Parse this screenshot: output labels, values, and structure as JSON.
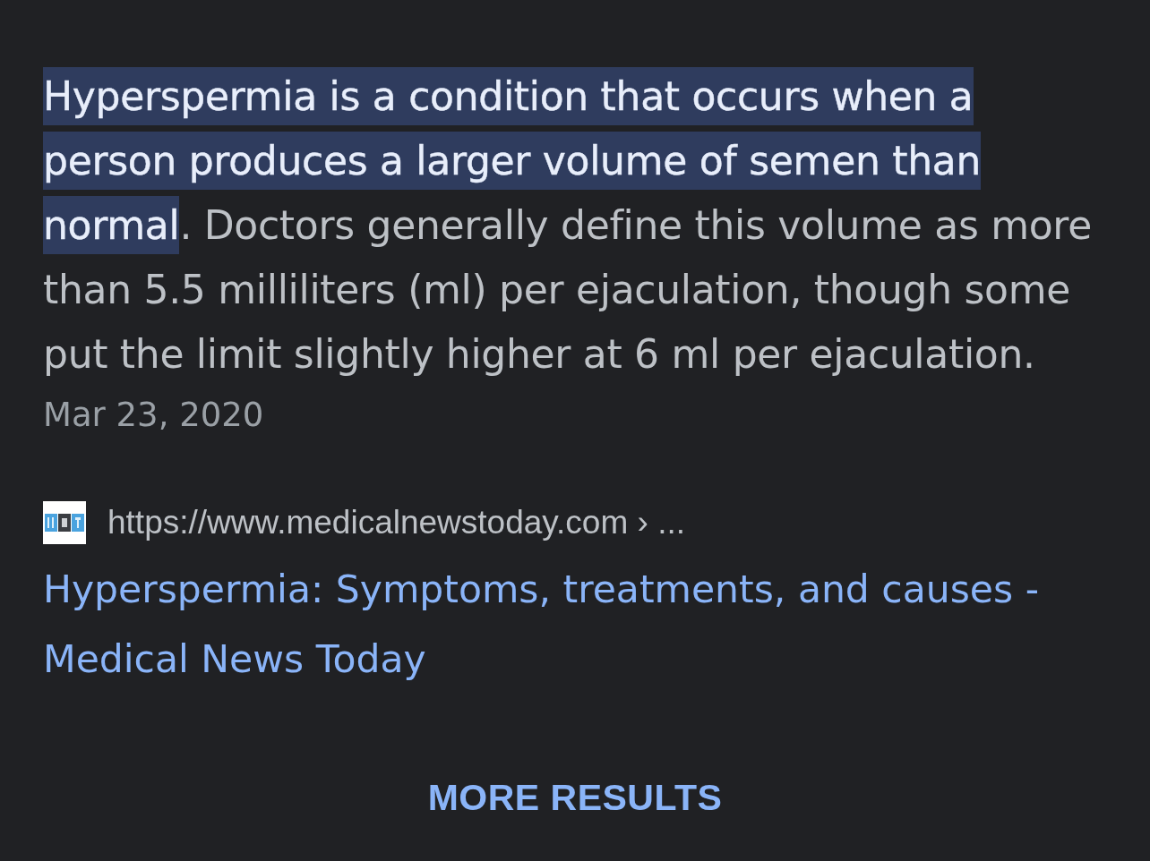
{
  "snippet": {
    "highlighted_text": "Hyperspermia is a condition that occurs when a person produces a larger volume of semen than normal",
    "text": ". Doctors generally define this volume as more than 5.5 milliliters (ml) per ejaculation, though some put the limit slightly higher at 6 ml per ejaculation.",
    "date": "Mar 23, 2020"
  },
  "result": {
    "url": "https://www.medicalnewstoday.com › ...",
    "title": "Hyperspermia: Symptoms, treatments, and causes - Medical News Today"
  },
  "more_results": {
    "label": "MORE RESULTS"
  }
}
